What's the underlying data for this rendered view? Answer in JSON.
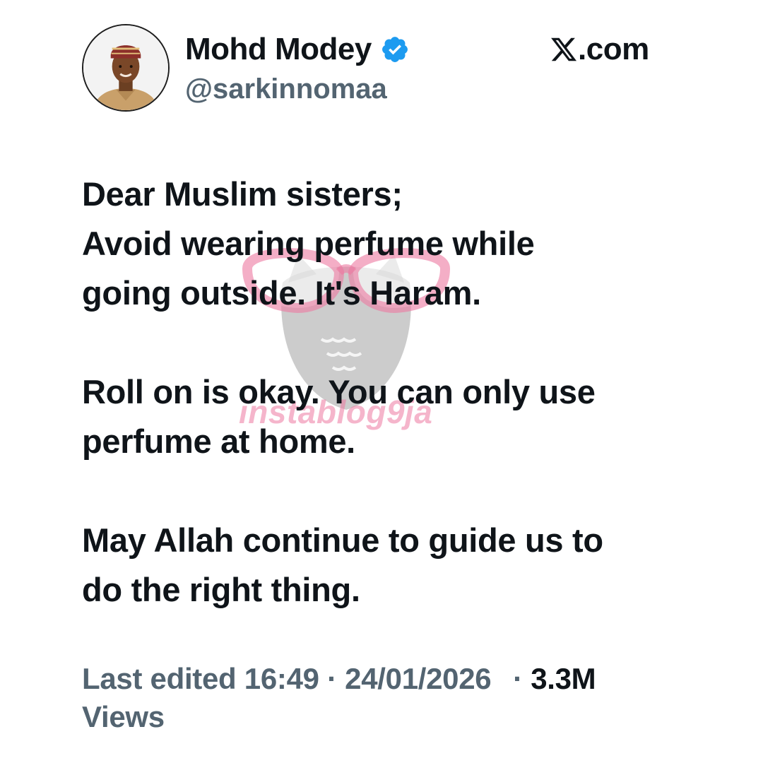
{
  "post": {
    "author": {
      "display_name": "Mohd Modey",
      "handle": "@sarkinnomaa",
      "verified": true,
      "verified_icon": "verified-badge-icon",
      "avatar_icon": "profile-photo"
    },
    "platform": {
      "logo_icon": "x-logo-icon",
      "domain_text": ".com"
    },
    "body": {
      "paragraphs": [
        {
          "lines": [
            "Dear Muslim sisters;",
            "Avoid wearing perfume while",
            "going outside. It's Haram."
          ]
        },
        {
          "lines": [
            "Roll on is okay. You can only use",
            "perfume at home."
          ]
        },
        {
          "lines": [
            "May Allah continue to guide us to",
            "do the right thing."
          ]
        }
      ]
    },
    "meta": {
      "edited_label": "Last edited",
      "time": "16:49",
      "separator": "·",
      "date": "24/01/2026",
      "views_count": "3.3M",
      "views_label": "Views"
    }
  },
  "watermark": {
    "text": "instablog9ja"
  },
  "colors": {
    "text_primary": "#0f1419",
    "text_secondary": "#536471",
    "verified_blue": "#1d9bf0",
    "watermark_pink": "#ec78a0",
    "watermark_gray": "#9a9a9a"
  }
}
